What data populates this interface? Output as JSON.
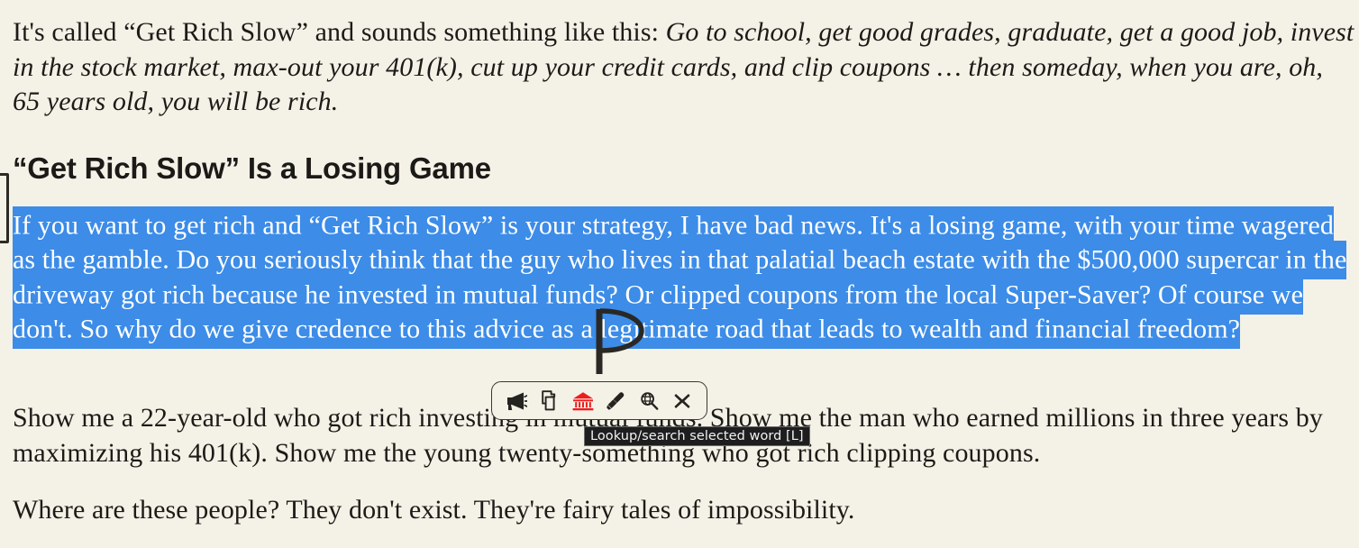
{
  "page": {
    "background_color": "#f4f1e7",
    "text_color": "#1d1b17",
    "selection_color": "#3c8ce8",
    "selection_text_color": "#ffffff"
  },
  "article": {
    "intro": {
      "lead": "It's called “Get Rich Slow” and sounds something like this: ",
      "quote": "Go to school, get good grades, graduate, get a good job, invest in the stock market, max-out your 401(k), cut up your credit cards, and clip coupons … then someday, when you are, oh, 65 years old, you will be rich."
    },
    "heading": "“Get Rich Slow” Is a Losing Game",
    "selected_paragraph": "If you want to get rich and “Get Rich Slow” is your strategy, I have bad news. It's a losing game, with your time wagered as the gamble. Do you seriously think that the guy who lives in that palatial beach estate with the $500,000 supercar in the driveway got rich because he invested in mutual funds? Or clipped coupons from the local Super-Saver? Of course we don't. So why do we give credence to this advice as a legitimate road that leads to wealth and financial freedom?",
    "paragraph_show": "Show me a 22-year-old who got rich investing in mutual funds. Show me the man who earned millions in three years by maximizing his 401(k). Show me the young twenty-something who got rich clipping coupons.",
    "paragraph_where": "Where are these people? They don't exist. They're fairy tales of impossibility."
  },
  "selection_toolbar": {
    "buttons": [
      {
        "name": "speak-icon",
        "label": "Speak selected text"
      },
      {
        "name": "copy-icon",
        "label": "Copy selected text"
      },
      {
        "name": "dictionary-icon",
        "label": "Dictionary lookup",
        "color": "#ee1c1c"
      },
      {
        "name": "highlighter-icon",
        "label": "Highlight selection"
      },
      {
        "name": "lookup-search-icon",
        "label": "Lookup/search selected word"
      },
      {
        "name": "close-icon",
        "label": "Close toolbar"
      }
    ]
  },
  "tooltip": {
    "text": "Lookup/search selected word [L]"
  }
}
